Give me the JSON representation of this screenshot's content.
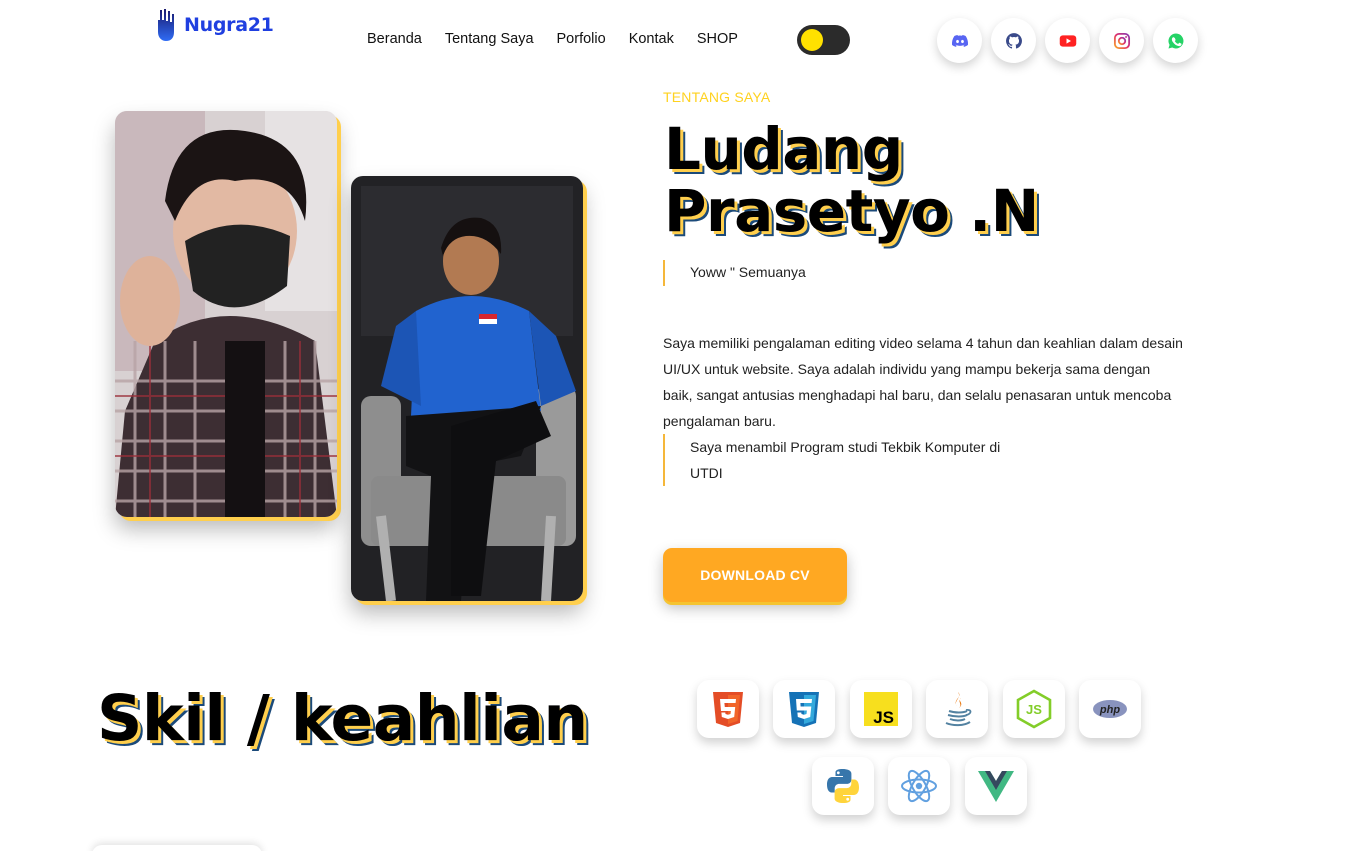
{
  "brand": {
    "name": "Nugra21",
    "logo_icon": "flame-logo-icon",
    "color": "#1f3fe0"
  },
  "nav": {
    "items": [
      {
        "label": "Beranda"
      },
      {
        "label": "Tentang Saya"
      },
      {
        "label": "Porfolio"
      },
      {
        "label": "Kontak"
      },
      {
        "label": "SHOP"
      }
    ]
  },
  "theme_toggle": {
    "state": "light",
    "knob_color": "#ffe100",
    "track_color": "#2b2b2b"
  },
  "socials": [
    {
      "icon": "discord-icon",
      "color": "#5865f2"
    },
    {
      "icon": "github-icon",
      "color": "#2b3137"
    },
    {
      "icon": "youtube-icon",
      "color": "#ff0000"
    },
    {
      "icon": "instagram-icon",
      "color": "#e1306c"
    },
    {
      "icon": "whatsapp-icon",
      "color": "#25d366"
    }
  ],
  "about": {
    "eyebrow": "TENTANG SAYA",
    "name_line1": "Ludang",
    "name_line2": "Prasetyo .N",
    "tagline": "Yoww \" Semuanya",
    "bio": "Saya memiliki pengalaman editing video selama 4 tahun dan keahlian dalam desain UI/UX untuk website. Saya adalah individu yang mampu bekerja sama dengan baik, sangat antusias menghadapi hal baru, dan selalu penasaran untuk mencoba pengalaman baru.",
    "study_line1": "Saya menambil Program studi Tekbik Komputer di",
    "study_line2": "UTDI",
    "cv_button": "DOWNLOAD CV",
    "accent_color": "#ffa822"
  },
  "skills": {
    "title": "Skil / keahlian",
    "items": [
      {
        "icon": "html5-icon"
      },
      {
        "icon": "css3-icon"
      },
      {
        "icon": "javascript-icon",
        "text": "JS"
      },
      {
        "icon": "java-icon"
      },
      {
        "icon": "nodejs-icon",
        "text": "JS"
      },
      {
        "icon": "php-icon",
        "text": "php"
      },
      {
        "icon": "python-icon"
      },
      {
        "icon": "react-icon"
      },
      {
        "icon": "vue-icon"
      }
    ]
  }
}
